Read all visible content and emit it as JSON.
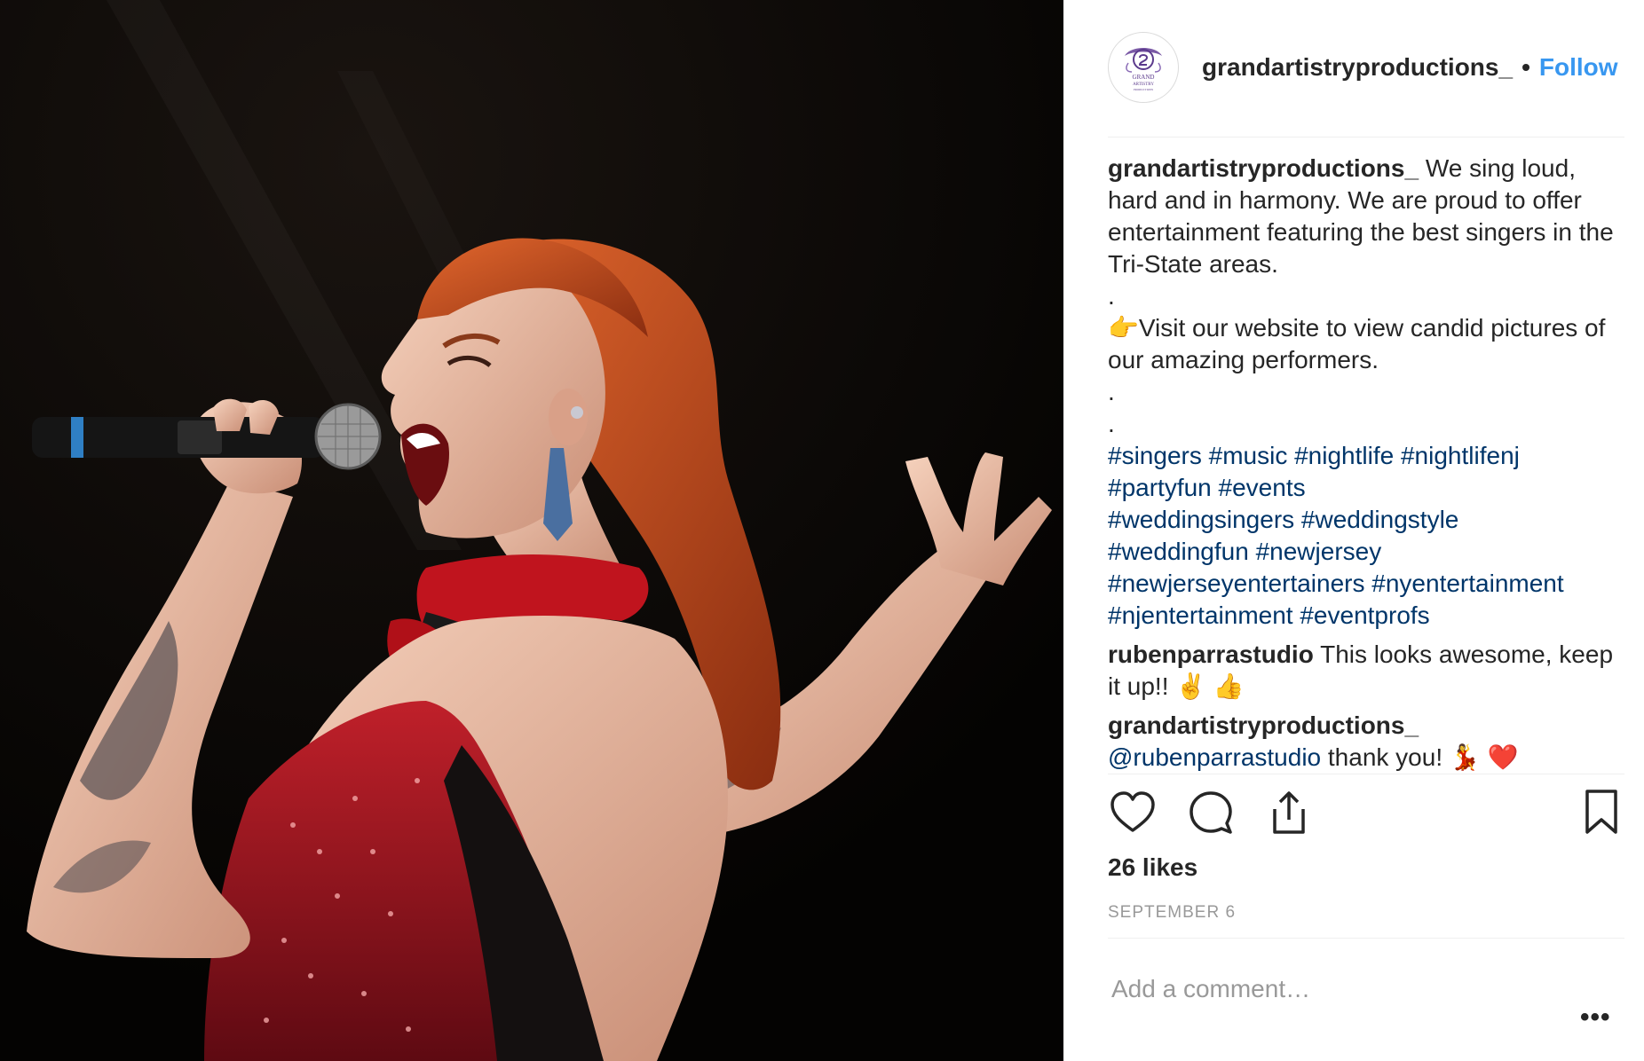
{
  "post": {
    "photo_alt": "",
    "author": {
      "username": "grandartistryproductions_",
      "avatar_text": [
        "GRAND",
        "ARTISTRY",
        "PRODUCTIONS"
      ],
      "follow_label": "Follow",
      "separator": "•"
    },
    "caption": {
      "username": "grandartistryproductions_",
      "line1": " We sing loud, hard and in harmony. We are proud to offer entertainment featuring the best singers in the Tri-State areas.",
      "dot1": ".",
      "emoji": "👉",
      "line2": "Visit our website to view candid pictures of our amazing performers.",
      "dot2": ".",
      "dot3": ".",
      "hashtags": [
        "#singers",
        "#music",
        "#nightlife",
        "#nightlifenj",
        "#partyfun",
        "#events",
        "#weddingsingers",
        "#weddingstyle",
        "#weddingfun",
        "#newjersey",
        "#newjerseyentertainers",
        "#nyentertainment",
        "#njentertainment",
        "#eventprofs"
      ]
    },
    "comments": [
      {
        "username": "rubenparrastudio",
        "text": " This looks awesome, keep it up!! ✌️ 👍"
      },
      {
        "username": "grandartistryproductions_",
        "mention": "@rubenparrastudio",
        "text": " thank you! 💃 ❤️"
      }
    ],
    "icons": {
      "like": "heart-icon",
      "comment": "comment-icon",
      "share": "share-icon",
      "save": "bookmark-icon"
    },
    "likes": "26 likes",
    "date": "SEPTEMBER 6",
    "comment_placeholder": "Add a comment…",
    "more_label": "•••",
    "colors": {
      "link": "#003569",
      "follow": "#3897f0",
      "text": "#262626",
      "muted": "#999999",
      "divider": "#efefef",
      "logo": "#5b3a8c"
    }
  }
}
